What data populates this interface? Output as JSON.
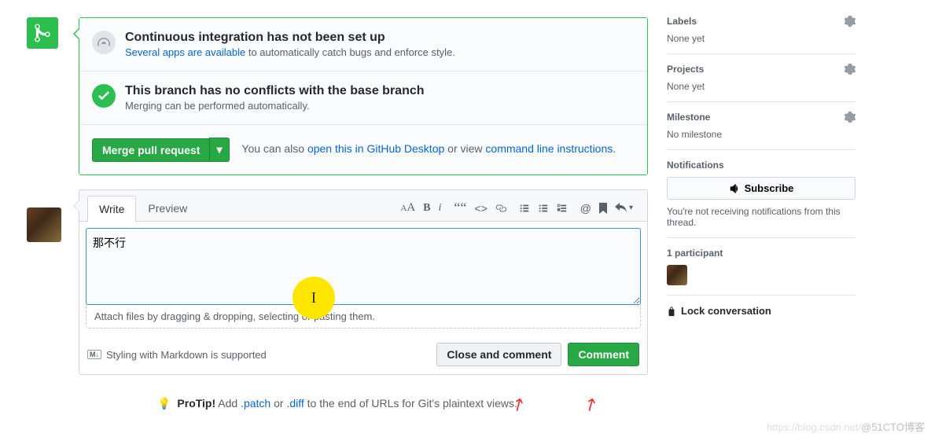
{
  "merge": {
    "ci_title": "Continuous integration has not been set up",
    "ci_link": "Several apps are available",
    "ci_text_after": " to automatically catch bugs and enforce style.",
    "conflict_title": "This branch has no conflicts with the base branch",
    "conflict_text": "Merging can be performed automatically.",
    "merge_btn": "Merge pull request",
    "alt_prefix": "You can also ",
    "alt_link1": "open this in GitHub Desktop",
    "alt_mid": " or view ",
    "alt_link2": "command line instructions"
  },
  "comment": {
    "tab_write": "Write",
    "tab_preview": "Preview",
    "text": "那不行",
    "attach_hint": "Attach files by dragging & dropping, selecting or pasting them.",
    "md_hint": "Styling with Markdown is supported",
    "close_btn": "Close and comment",
    "comment_btn": "Comment"
  },
  "protip": {
    "label": "ProTip!",
    "before": " Add ",
    "l1": ".patch",
    "mid": " or ",
    "l2": ".diff",
    "after": " to the end of URLs for Git's plaintext views."
  },
  "sidebar": {
    "labels_h": "Labels",
    "labels_v": "None yet",
    "projects_h": "Projects",
    "projects_v": "None yet",
    "milestone_h": "Milestone",
    "milestone_v": "No milestone",
    "notif_h": "Notifications",
    "subscribe": "Subscribe",
    "notif_note": "You're not receiving notifications from this thread.",
    "participants_h": "1 participant",
    "lock": "Lock conversation"
  },
  "watermark": "@51CTO博客"
}
